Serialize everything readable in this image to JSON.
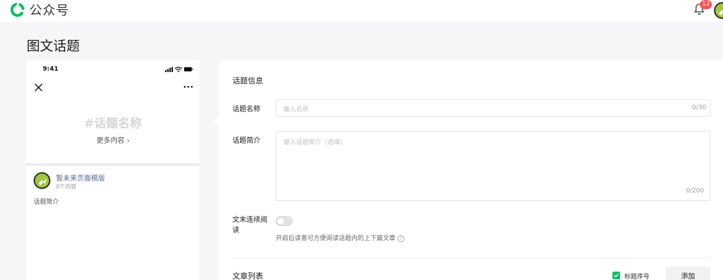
{
  "header": {
    "brand": "公众号",
    "notifications": "12"
  },
  "page": {
    "title": "图文话题"
  },
  "preview": {
    "time": "9:41",
    "topic_placeholder": "#话题名称",
    "more_content": "更多内容",
    "more_chevron": "›",
    "account_name": "暂未来页面模版",
    "article_count": "0个内容",
    "intro_label": "话题简介"
  },
  "form": {
    "section_title": "话题信息",
    "name_label": "话题名称",
    "name_placeholder": "输入名称",
    "name_counter": "0/30",
    "intro_label": "话题简介",
    "intro_placeholder": "输入话题简介（选填）",
    "intro_counter": "0/200",
    "continuous_label": "文末连续阅读",
    "continuous_enabled": false,
    "continuous_hint": "开启后读者可方便阅读话题内的上下篇文章",
    "help_glyph": "?",
    "list_title": "文章列表",
    "title_number_label": "标题序号",
    "title_number_checked": true,
    "add_button": "添加"
  },
  "colors": {
    "accent": "#07c160",
    "badge": "#fa5151",
    "link": "#576b95"
  },
  "icons": [
    "logo-icon",
    "bell-icon",
    "close-icon",
    "more-icon",
    "signal-icon",
    "wifi-icon",
    "battery-icon",
    "help-icon",
    "check-icon"
  ]
}
